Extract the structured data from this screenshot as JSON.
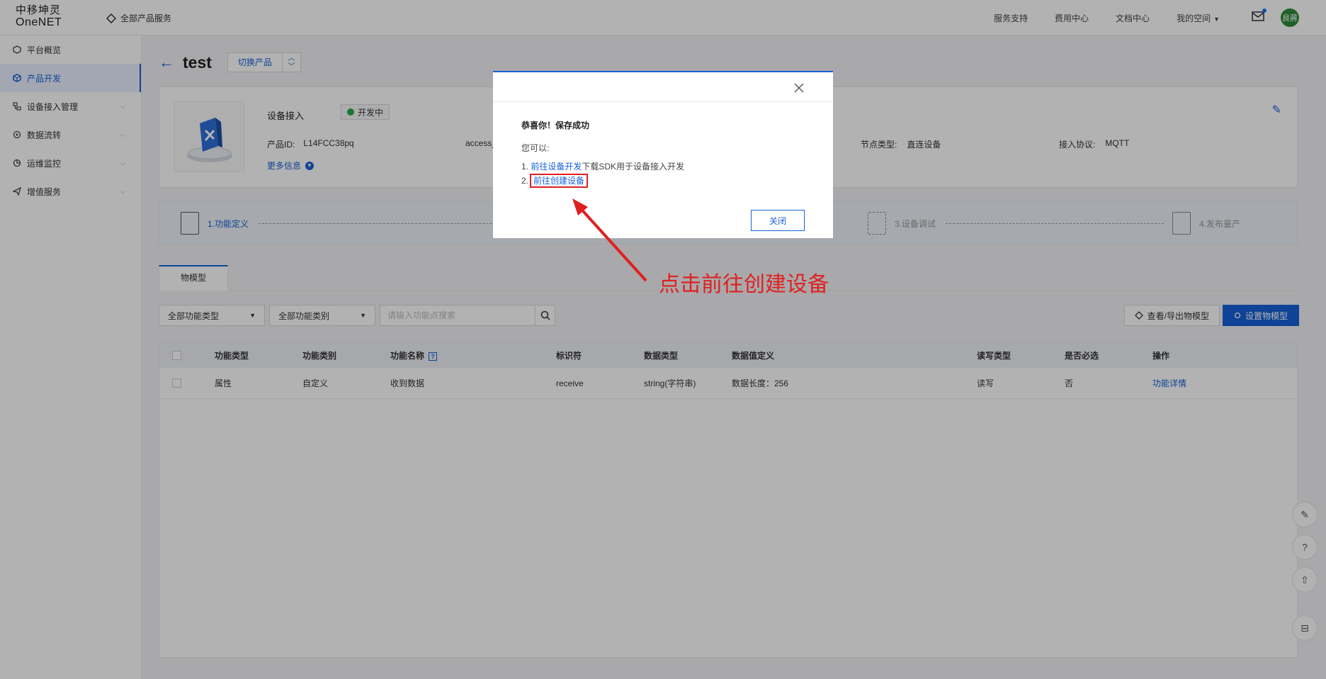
{
  "header": {
    "logo_cn": "中移坤灵",
    "logo_en": "OneNET",
    "all_products": "全部产品服务",
    "nav": [
      "服务支持",
      "费用中心",
      "文档中心",
      "我的空间"
    ],
    "avatar_text": "良蔣"
  },
  "sidebar": {
    "items": [
      {
        "label": "平台概览"
      },
      {
        "label": "产品开发"
      },
      {
        "label": "设备接入管理"
      },
      {
        "label": "数据流转"
      },
      {
        "label": "运维监控"
      },
      {
        "label": "增值服务"
      }
    ]
  },
  "page": {
    "title": "test",
    "switch_label": "切换产品"
  },
  "product": {
    "name": "设备接入",
    "status": "开发中",
    "id_label": "产品ID:",
    "id_value": "L14FCC38pq",
    "access_label": "access_",
    "node_label": "节点类型:",
    "node_value": "直连设备",
    "proto_label": "接入协议:",
    "proto_value": "MQTT",
    "more": "更多信息"
  },
  "steps": [
    "1.功能定义",
    "3.设备调试",
    "4.发布量产"
  ],
  "tabs": [
    "物模型"
  ],
  "filters": {
    "type": "全部功能类型",
    "category": "全部功能类别",
    "search_placeholder": "请输入功能点搜索"
  },
  "actions": {
    "export": "查看/导出物模型",
    "set": "设置物模型"
  },
  "table": {
    "headers": [
      "功能类型",
      "功能类别",
      "功能名称",
      "标识符",
      "数据类型",
      "数据值定义",
      "读写类型",
      "是否必选",
      "操作"
    ],
    "rows": [
      [
        "属性",
        "自定义",
        "收到数据",
        "receive",
        "string(字符串)",
        "数据长度：256",
        "读写",
        "否",
        "功能详情"
      ]
    ]
  },
  "modal": {
    "title": "恭喜你！保存成功",
    "intro": "您可以:",
    "line1_prefix": "1. ",
    "line1_link": "前往设备开发",
    "line1_suffix": "下载SDK用于设备接入开发",
    "line2_prefix": "2.",
    "line2_link": "前往创建设备",
    "close_button": "关闭"
  },
  "annotation": {
    "text": "点击前往创建设备",
    "color": "#e02020"
  },
  "colors": {
    "primary": "#1660d8",
    "status_green": "#27a844"
  }
}
